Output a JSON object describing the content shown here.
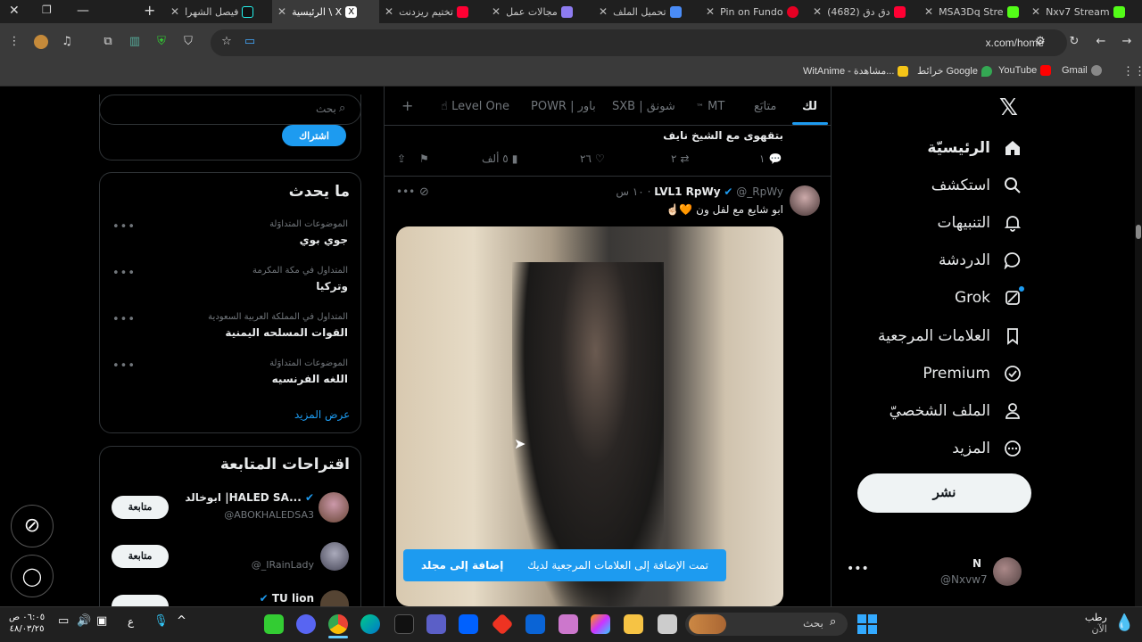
{
  "browser": {
    "tabs": [
      {
        "title": "Nxv7 Stream",
        "icon_color": "#53fc18"
      },
      {
        "title": "MSA3Dq Stre",
        "icon_color": "#53fc18"
      },
      {
        "title": "(4682) دق دق",
        "icon_color": "#ff0033"
      },
      {
        "title": "Pin on Fundo",
        "icon_color": "#e60023"
      },
      {
        "title": "تحميل الملف",
        "icon_color": "#4a8cf7"
      },
      {
        "title": "مجالات عمل",
        "icon_color": "#8e7cf0"
      },
      {
        "title": "تختيم ريزدنت",
        "icon_color": "#ff0033"
      },
      {
        "title": "الرئيسية \\ X",
        "icon_color": "#ffffff"
      },
      {
        "title": "فيصل الشهرا",
        "icon_color": "#ffffff"
      }
    ],
    "url": "x.com/home",
    "bookmarks": [
      {
        "label": "Gmail",
        "icon_color": "#ea4335"
      },
      {
        "label": "YouTube",
        "icon_color": "#ff0000"
      },
      {
        "label": "خرائط Google",
        "icon_color": "#34a853"
      },
      {
        "label": "WitAnime - مشاهدة...",
        "icon_color": "#f5c518"
      }
    ]
  },
  "nav": {
    "items": [
      {
        "label": "الرئيسيّة",
        "icon": "home-icon"
      },
      {
        "label": "استكشف",
        "icon": "search-icon"
      },
      {
        "label": "التنبيهات",
        "icon": "bell-icon"
      },
      {
        "label": "الدردشة",
        "icon": "chat-icon"
      },
      {
        "label": "Grok",
        "icon": "grok-icon"
      },
      {
        "label": "العلامات المرجعية",
        "icon": "bookmark-icon"
      },
      {
        "label": "Premium",
        "icon": "verified-icon"
      },
      {
        "label": "الملف الشخصيّ",
        "icon": "person-icon"
      },
      {
        "label": "المزيد",
        "icon": "more-icon"
      }
    ],
    "post_label": "نشر",
    "account": {
      "name": "N",
      "handle": "@Nxvw7"
    }
  },
  "feed": {
    "tabs": [
      "لك",
      "متابَع",
      "MT",
      "SXB | شونق",
      "POWR | باور",
      "Level One"
    ],
    "prev_tweet_text": "بتقهوى مع الشيخ نايف",
    "prev_actions": {
      "replies": "١",
      "retweets": "٢",
      "likes": "٢٦",
      "views": "٥ ألف"
    },
    "tweet": {
      "name": "LVL1 RpWy",
      "handle": "@_RpWy",
      "time": "١٠ س",
      "text": "ابو شايع مع لفل ون 🧡☝🏻"
    },
    "toast": {
      "message": "تمت الإضافة إلى العلامات المرجعية لديك",
      "action": "إضافة إلى مجلد"
    }
  },
  "sidebar": {
    "search_placeholder": "بحث",
    "subscribe_label": "اشتراك",
    "trends_title": "ما يحدث",
    "trends": [
      {
        "meta": "الموضوعات المتداوَلة",
        "name": "جوي بوي"
      },
      {
        "meta": "المتداول في مكة المكرمة",
        "name": "وتركيا"
      },
      {
        "meta": "المتداول في المملكة العربية السعودية",
        "name": "القوات المسلحه اليمنية"
      },
      {
        "meta": "الموضوعات المتداوَلة",
        "name": "اللغه الفرنسيه"
      }
    ],
    "show_more": "عرض المزيد",
    "follow_title": "اقتراحات المتابعة",
    "suggestions": [
      {
        "name": "ابوخالد |HALED SA...",
        "handle": "@ABOKHALEDSA3",
        "verified": true
      },
      {
        "name": "",
        "handle": "@_IRainLady",
        "verified": false
      },
      {
        "name": "TU lion",
        "handle": "",
        "verified": true
      }
    ],
    "follow_label": "متابعة"
  },
  "taskbar": {
    "search_placeholder": "بحث",
    "time": "٠٦:٠٥ ص",
    "date": "٤٨/٠٣/٢٥",
    "weather": "رطب",
    "weather_sub": "الآن",
    "lang": "ع"
  }
}
